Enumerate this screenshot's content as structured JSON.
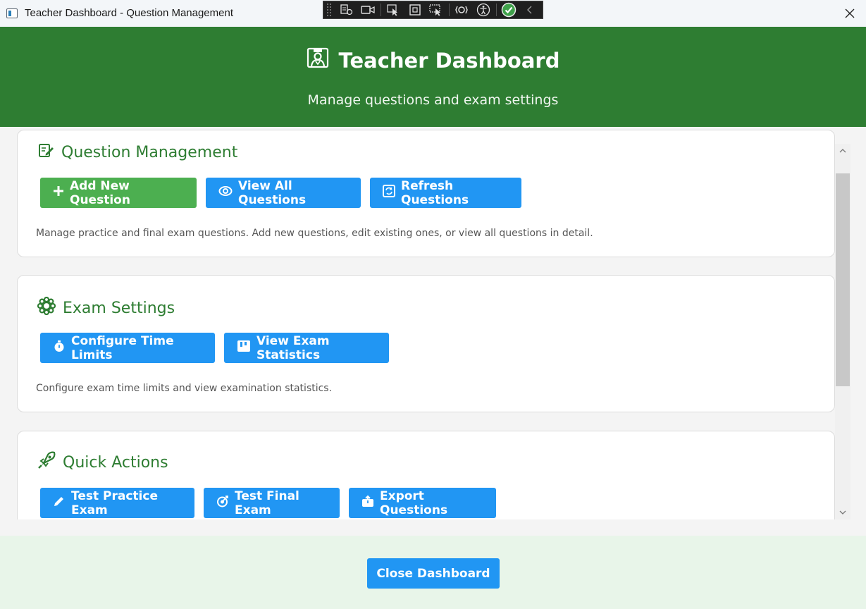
{
  "window": {
    "title": "Teacher Dashboard - Question Management"
  },
  "header": {
    "title": "Teacher Dashboard",
    "subtitle": "Manage questions and exam settings"
  },
  "sections": [
    {
      "title": "Question Management",
      "description": "Manage practice and final exam questions. Add new questions, edit existing ones, or view all questions in detail.",
      "buttons": [
        {
          "label": "Add New Question",
          "icon": "plus-icon",
          "color": "#4caf50"
        },
        {
          "label": "View All Questions",
          "icon": "eye-icon",
          "color": "#2196f3"
        },
        {
          "label": "Refresh Questions",
          "icon": "refresh-icon",
          "color": "#2196f3"
        }
      ]
    },
    {
      "title": "Exam Settings",
      "description": "Configure exam time limits and view examination statistics.",
      "buttons": [
        {
          "label": "Configure Time Limits",
          "icon": "stopwatch-icon",
          "color": "#2196f3"
        },
        {
          "label": "View Exam Statistics",
          "icon": "chart-icon",
          "color": "#2196f3"
        }
      ]
    },
    {
      "title": "Quick Actions",
      "buttons": [
        {
          "label": "Test Practice Exam",
          "icon": "pencil-icon",
          "color": "#2196f3"
        },
        {
          "label": "Test Final Exam",
          "icon": "target-icon",
          "color": "#2196f3"
        },
        {
          "label": "Export Questions",
          "icon": "export-icon",
          "color": "#2196f3"
        }
      ]
    }
  ],
  "footer": {
    "close_label": "Close Dashboard"
  },
  "colors": {
    "header": "#2e7d32",
    "accent_green": "#4caf50",
    "accent_blue": "#2196f3",
    "footer": "#e8f5e9"
  }
}
